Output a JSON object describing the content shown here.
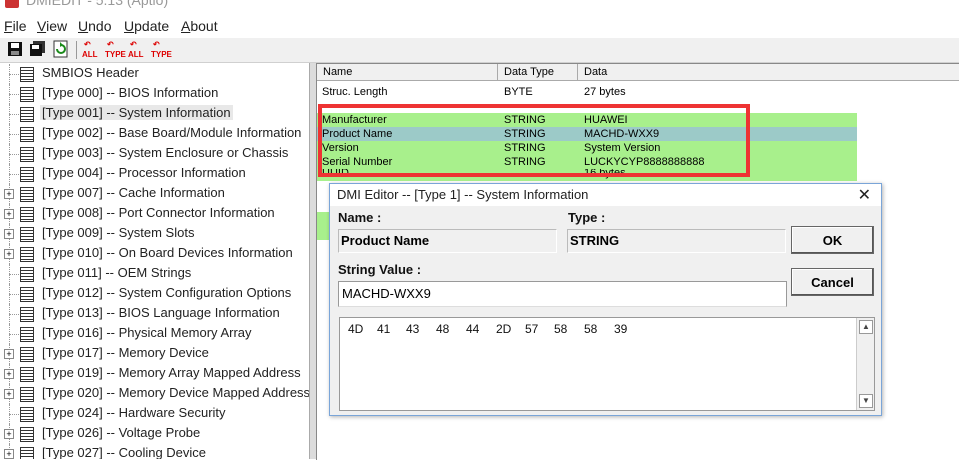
{
  "window": {
    "title": "DMIEDIT - 5.13 (Aptio)"
  },
  "menu": [
    {
      "label": "File",
      "u": "F",
      "rest": "ile"
    },
    {
      "label": "View",
      "u": "V",
      "rest": "iew"
    },
    {
      "label": "Undo",
      "u": "U",
      "rest": "ndo"
    },
    {
      "label": "Update",
      "u": "U",
      "rest": "pdate"
    },
    {
      "label": "About",
      "u": "A",
      "rest": "bout"
    }
  ],
  "toolbar": {
    "btn_all1": {
      "top": "↶",
      "bot": "ALL"
    },
    "btn_type1": {
      "top": "↶",
      "bot": "TYPE"
    },
    "btn_all2": {
      "top": "↶",
      "bot": "ALL"
    },
    "btn_type2": {
      "top": "↶",
      "bot": "TYPE"
    }
  },
  "tree": {
    "items": [
      "SMBIOS Header",
      "[Type 000] -- BIOS Information",
      "[Type 001] -- System Information",
      "[Type 002] -- Base Board/Module Information",
      "[Type 003] -- System Enclosure or Chassis",
      "[Type 004] -- Processor Information",
      "[Type 007] -- Cache Information",
      "[Type 008] -- Port Connector Information",
      "[Type 009] -- System Slots",
      "[Type 010] -- On Board Devices Information",
      "[Type 011] -- OEM Strings",
      "[Type 012] -- System Configuration Options",
      "[Type 013] -- BIOS Language Information",
      "[Type 016] -- Physical Memory Array",
      "[Type 017] -- Memory Device",
      "[Type 019] -- Memory Array Mapped Address",
      "[Type 020] -- Memory Device Mapped Address",
      "[Type 024] -- Hardware Security",
      "[Type 026] -- Voltage Probe",
      "[Type 027] -- Cooling Device"
    ]
  },
  "grid": {
    "headers": [
      "Name",
      "Data Type",
      "Data"
    ],
    "rows": [
      [
        "Struc. Length",
        "BYTE",
        "27 bytes"
      ],
      [
        "Manufacturer",
        "STRING",
        "HUAWEI"
      ],
      [
        "Product Name",
        "STRING",
        "MACHD-WXX9"
      ],
      [
        "Version",
        "STRING",
        "System Version"
      ],
      [
        "Serial Number",
        "STRING",
        "LUCKYCYP8888888888"
      ],
      [
        "UUID",
        "",
        "16 bytes"
      ]
    ]
  },
  "dialog": {
    "title": "DMI Editor -- [Type   1] -- System Information",
    "name_label": "Name :",
    "name_value": "Product Name",
    "type_label": "Type :",
    "type_value": "STRING",
    "string_label": "String Value :",
    "string_value": "MACHD-WXX9",
    "ok": "OK",
    "cancel": "Cancel",
    "hex": [
      "4D",
      "41",
      "43",
      "48",
      "44",
      "2D",
      "57",
      "58",
      "58",
      "39"
    ]
  },
  "colors": {
    "highlight": "#ee3333",
    "row_green": "#a8f08c",
    "row_selected": "#9ccac8"
  }
}
